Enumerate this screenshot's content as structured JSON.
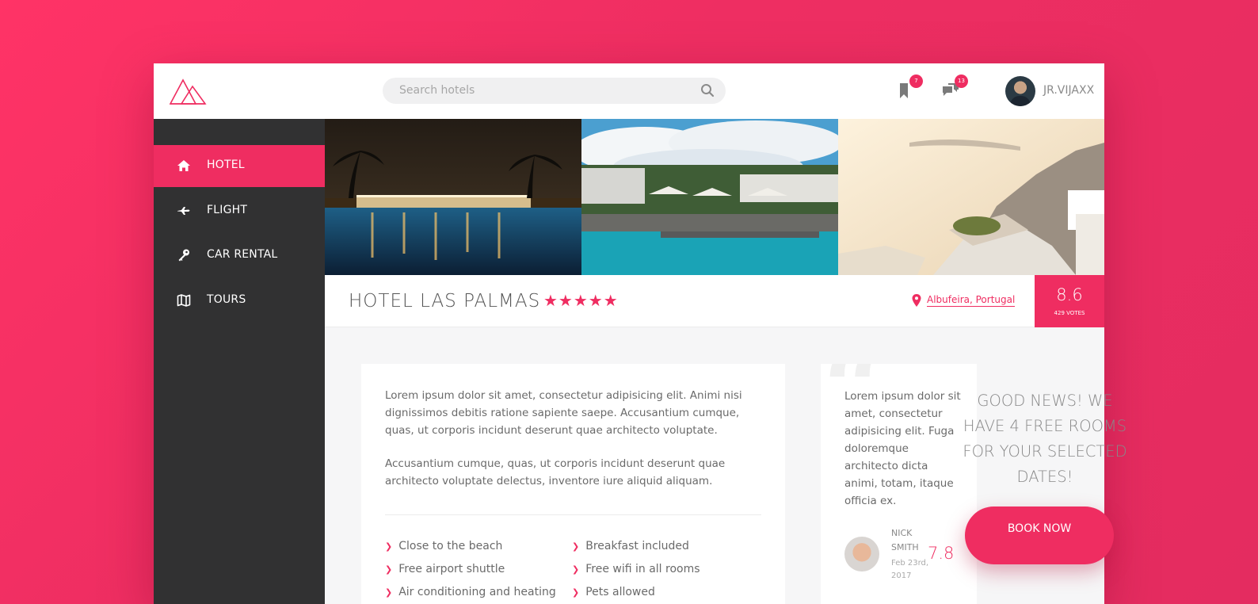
{
  "header": {
    "search_placeholder": "Search hotels",
    "bookmarks_count": "7",
    "messages_count": "13",
    "username": "JR.VIJAXX"
  },
  "sidebar": {
    "items": [
      {
        "label": "HOTEL",
        "icon": "home-icon",
        "active": true
      },
      {
        "label": "FLIGHT",
        "icon": "plane-icon",
        "active": false
      },
      {
        "label": "CAR RENTAL",
        "icon": "key-icon",
        "active": false
      },
      {
        "label": "TOURS",
        "icon": "map-icon",
        "active": false
      }
    ]
  },
  "hotel": {
    "name": "HOTEL LAS PALMAS",
    "stars": "★★★★★",
    "location": "Albufeira, Portugal",
    "score": "8.6",
    "votes": "429 VOTES"
  },
  "description": {
    "paragraphs": [
      "Lorem ipsum dolor sit amet, consectetur adipisicing elit. Animi nisi dignissimos debitis ratione sapiente saepe. Accusantium cumque, quas, ut corporis incidunt deserunt quae architecto voluptate.",
      "Accusantium cumque, quas, ut corporis incidunt deserunt quae architecto voluptate delectus, inventore iure aliquid aliquam."
    ],
    "features": [
      "Close to the beach",
      "Breakfast included",
      "Free airport shuttle",
      "Free wifi in all rooms",
      "Air conditioning and heating",
      "Pets allowed"
    ]
  },
  "review": {
    "text": "Lorem ipsum dolor sit amet, consectetur adipisicing elit. Fuga doloremque architecto dicta animi, totam, itaque officia ex.",
    "reviewer": "NICK SMITH",
    "date": "Feb 23rd, 2017",
    "score": "7.8"
  },
  "promo": {
    "text": "GOOD NEWS! WE HAVE 4 FREE ROOMS FOR YOUR SELECTED DATES!",
    "button_label": "BOOK NOW"
  },
  "colors": {
    "accent": "#ef2d61",
    "sidebar_bg": "#313132",
    "background": "#ff3366"
  }
}
